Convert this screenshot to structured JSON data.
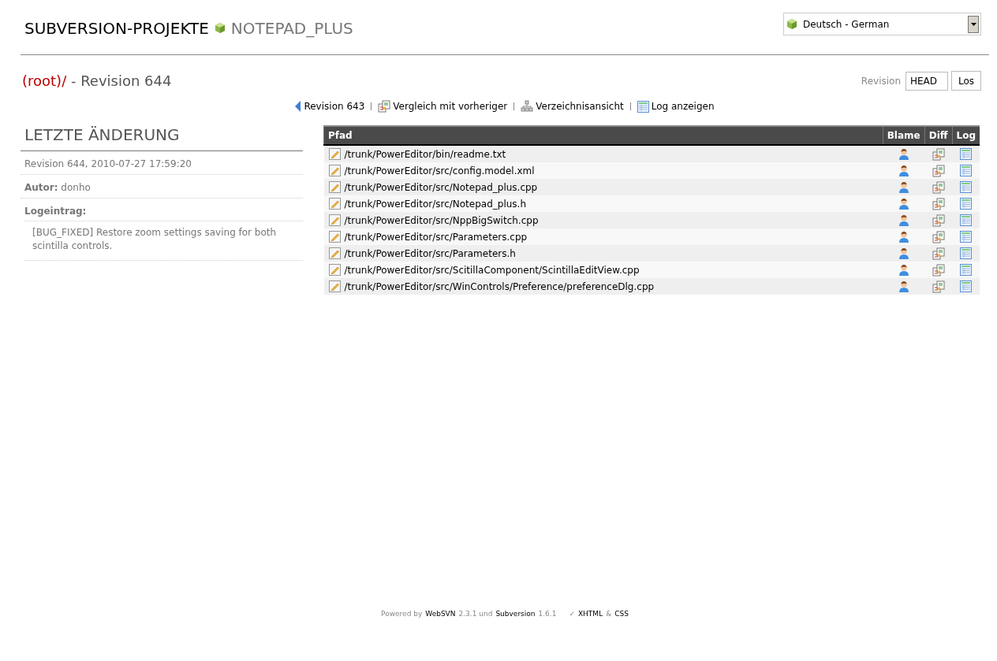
{
  "header": {
    "title": "SUBVERSION-PROJEKTE",
    "project": "NOTEPAD_PLUS",
    "language": "Deutsch - German"
  },
  "path": {
    "root": "(root)",
    "separator": "/",
    "revision": " - Revision 644"
  },
  "revision_form": {
    "label": "Revision",
    "value": "HEAD",
    "button": "Los"
  },
  "nav": [
    {
      "kind": "prev",
      "label": "Revision 643"
    },
    {
      "kind": "diff",
      "label": "Vergleich mit vorheriger"
    },
    {
      "kind": "dir",
      "label": "Verzeichnisansicht"
    },
    {
      "kind": "log",
      "label": "Log anzeigen"
    }
  ],
  "last_change": {
    "heading": "LETZTE ÄNDERUNG",
    "revision": "Revision 644, 2010-07-27 17:59:20",
    "author_label": "Autor:",
    "author": "donho",
    "log_label": "Logeintrag:",
    "log": "[BUG_FIXED] Restore zoom settings saving for both scintilla controls."
  },
  "table": {
    "columns": [
      "Pfad",
      "Blame",
      "Diff",
      "Log"
    ],
    "rows": [
      {
        "path": "/trunk/PowerEditor/bin/readme.txt"
      },
      {
        "path": "/trunk/PowerEditor/src/config.model.xml"
      },
      {
        "path": "/trunk/PowerEditor/src/Notepad_plus.cpp"
      },
      {
        "path": "/trunk/PowerEditor/src/Notepad_plus.h"
      },
      {
        "path": "/trunk/PowerEditor/src/NppBigSwitch.cpp"
      },
      {
        "path": "/trunk/PowerEditor/src/Parameters.cpp"
      },
      {
        "path": "/trunk/PowerEditor/src/Parameters.h"
      },
      {
        "path": "/trunk/PowerEditor/src/ScitillaComponent/ScintillaEditView.cpp"
      },
      {
        "path": "/trunk/PowerEditor/src/WinControls/Preference/preferenceDlg.cpp"
      }
    ]
  },
  "footer": {
    "powered": "Powered by",
    "websvn": "WebSVN",
    "websvn_version": "2.3.1 und",
    "subversion": "Subversion",
    "subversion_version": "1.6.1",
    "check": "✓",
    "xhtml": "XHTML",
    "amp": "&",
    "css": "CSS"
  }
}
